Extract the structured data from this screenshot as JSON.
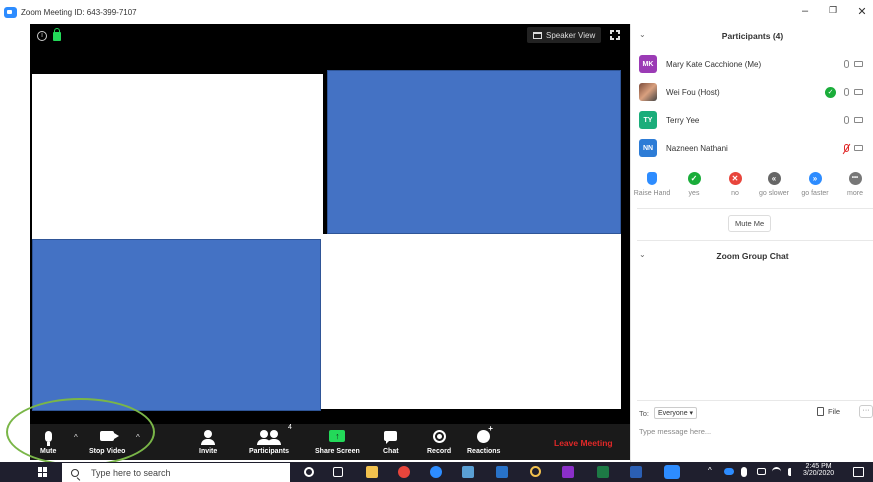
{
  "window": {
    "title": "Zoom Meeting ID: 643-399-7107",
    "controls": [
      "–",
      "❐",
      "✕"
    ]
  },
  "video": {
    "speaker_view_label": "Speaker View"
  },
  "toolbar": {
    "mute_label": "Mute",
    "stop_video_label": "Stop Video",
    "invite_label": "Invite",
    "participants_label": "Participants",
    "participants_count": "4",
    "share_screen_label": "Share Screen",
    "share_arrow": "↑",
    "chat_label": "Chat",
    "record_label": "Record",
    "reactions_label": "Reactions",
    "leave_label": "Leave Meeting",
    "caret": "^"
  },
  "participants": {
    "title": "Participants (4)",
    "chevron": "⌄",
    "list": [
      {
        "initials": "MK",
        "name": "Mary Kate Cacchione (Me)",
        "color": "#9b3bb5"
      },
      {
        "initials": "",
        "name": "Wei Fou (Host)",
        "color": "#8a5a44"
      },
      {
        "initials": "TY",
        "name": "Terry Yee",
        "color": "#1aad7a"
      },
      {
        "initials": "NN",
        "name": "Nazneen Nathani",
        "color": "#2d7cd6"
      }
    ],
    "host_check": "✓"
  },
  "reactions": [
    {
      "label": "Raise Hand",
      "symbol": "",
      "color": "#2d8cff"
    },
    {
      "label": "yes",
      "symbol": "✓",
      "color": "#1aad3a"
    },
    {
      "label": "no",
      "symbol": "✕",
      "color": "#e8453c"
    },
    {
      "label": "go slower",
      "symbol": "«",
      "color": "#666666"
    },
    {
      "label": "go faster",
      "symbol": "»",
      "color": "#2d8cff"
    },
    {
      "label": "more",
      "symbol": "•••",
      "color": "#777777"
    }
  ],
  "mute_me_label": "Mute Me",
  "chat": {
    "title": "Zoom Group Chat",
    "to_label": "To:",
    "to_value": "Everyone ▾",
    "file_label": "File",
    "more_label": "···",
    "placeholder": "Type message here..."
  },
  "taskbar": {
    "search_placeholder": "Type here to search",
    "time": "2:45 PM",
    "date": "3/20/2020"
  }
}
